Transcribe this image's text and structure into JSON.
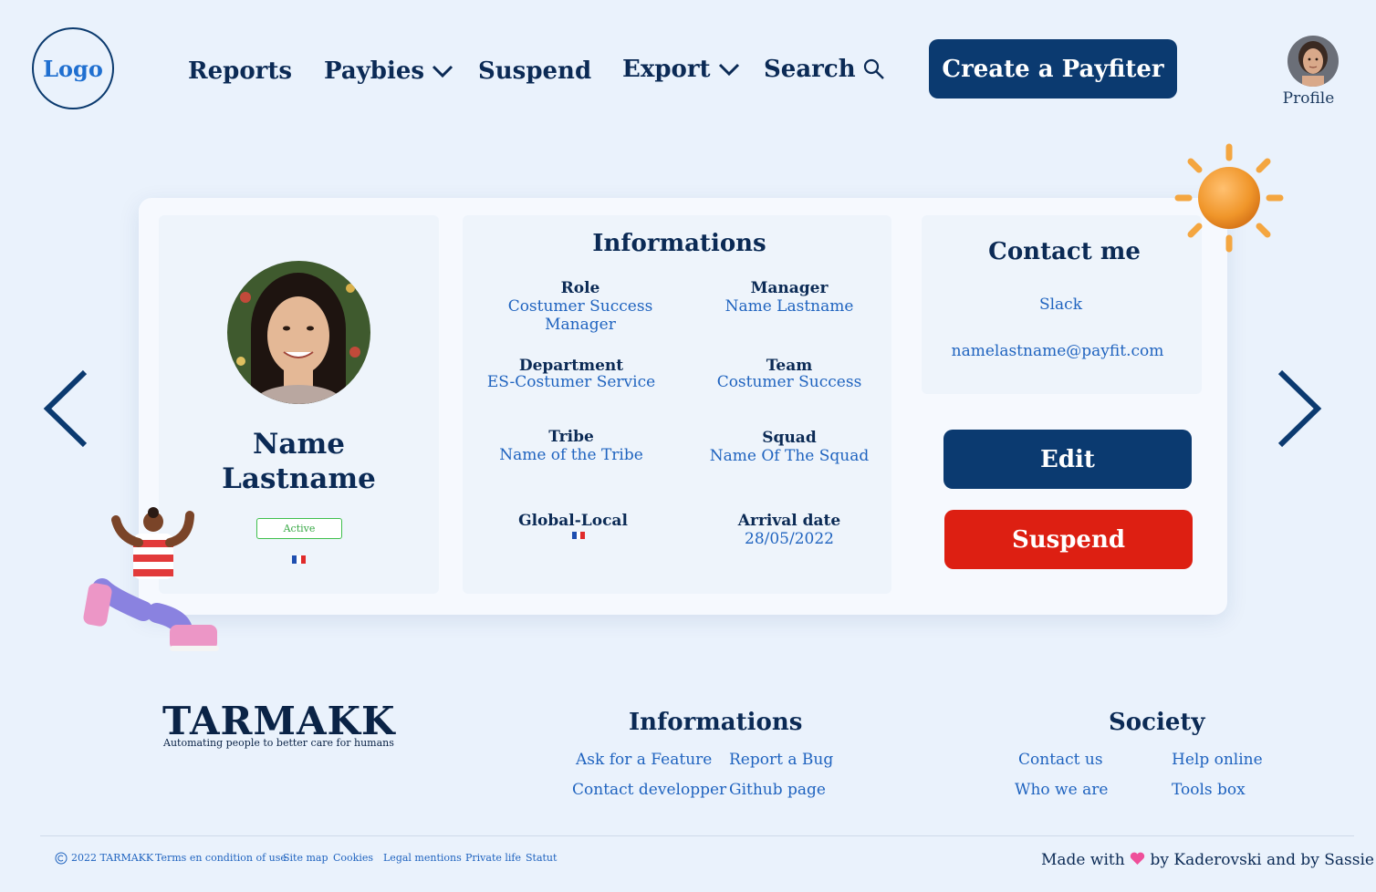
{
  "header": {
    "logo_text": "Logo",
    "nav": {
      "reports": "Reports",
      "paybies": "Paybies",
      "suspend": "Suspend",
      "export": "Export",
      "search": "Search"
    },
    "cta_label": "Create a Payfiter",
    "profile_label": "Profile"
  },
  "profile": {
    "name_first": "Name",
    "name_last": "Lastname",
    "status": "Active",
    "country_flag": "flag-france"
  },
  "informations": {
    "title": "Informations",
    "role": {
      "label": "Role",
      "value": "Costumer Success Manager"
    },
    "manager": {
      "label": "Manager",
      "value": "Name Lastname"
    },
    "department": {
      "label": "Department",
      "value": "ES-Costumer Service"
    },
    "team": {
      "label": "Team",
      "value": "Costumer Success"
    },
    "tribe": {
      "label": "Tribe",
      "value": "Name of the Tribe"
    },
    "squad": {
      "label": "Squad",
      "value": "Name Of The Squad"
    },
    "global_local": {
      "label": "Global-Local",
      "value_flag": "flag-france"
    },
    "arrival_date": {
      "label": "Arrival date",
      "value": "28/05/2022"
    }
  },
  "contact": {
    "title": "Contact me",
    "slack": "Slack",
    "email": "namelastname@payfit.com"
  },
  "actions": {
    "edit": "Edit",
    "suspend": "Suspend"
  },
  "footer": {
    "brand": "TARMAKK",
    "tagline": "Automating people to better care for humans",
    "informations": {
      "title": "Informations",
      "ask_feature": "Ask for a Feature",
      "report_bug": "Report a Bug",
      "contact_dev": "Contact developper",
      "github": "Github page"
    },
    "society": {
      "title": "Society",
      "contact_us": "Contact us",
      "help_online": "Help online",
      "who_we_are": "Who we are",
      "tools_box": "Tools box"
    },
    "legal": {
      "copyright": "2022 TARMAKK",
      "terms": "Terms en condition of use",
      "sitemap": "Site map",
      "cookies": "Cookies",
      "legal_mentions": "Legal mentions",
      "private_life": "Private life",
      "statut": "Statut"
    },
    "made_with": "Made with",
    "made_by": "by Kaderovski and by Sassie"
  },
  "colors": {
    "background": "#eaf2fc",
    "primary": "#0b3a70",
    "danger": "#dd1f12",
    "link": "#1f63bf",
    "active": "#3fbf4c"
  }
}
